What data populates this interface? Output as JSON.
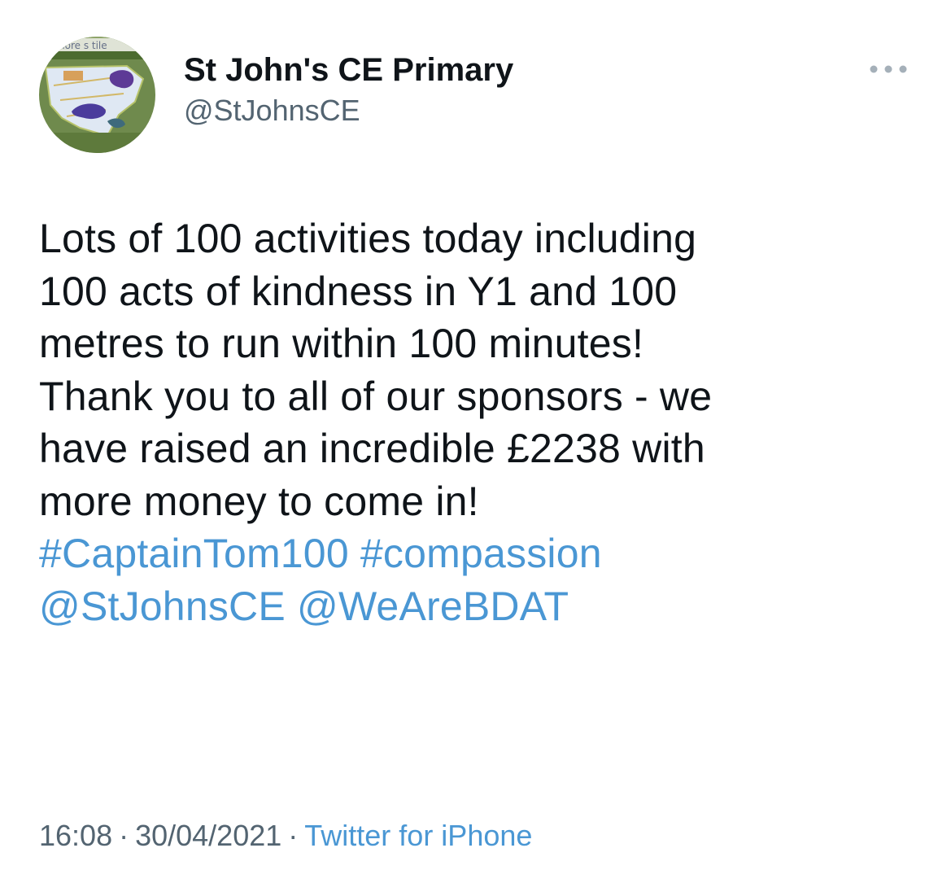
{
  "tweet": {
    "author": {
      "display_name": "St John's CE Primary",
      "handle": "@StJohnsCE",
      "avatar_text": "nore s tile"
    },
    "more_icon": "ellipsis-icon",
    "text_lines": [
      "Lots of 100 activities today including",
      "100 acts of kindness in Y1 and 100",
      "metres to run within 100 minutes!",
      "Thank you to all of our sponsors - we",
      "have raised an incredible £2238 with",
      "more money to come in!"
    ],
    "hashtags": [
      "#CaptainTom100",
      "#compassion"
    ],
    "mentions": [
      "@StJohnsCE",
      "@WeAreBDAT"
    ],
    "time": "16:08",
    "date": "30/04/2021",
    "separator": "·",
    "source": "Twitter for iPhone"
  },
  "colors": {
    "link": "#4a97d4",
    "text": "#0f1419",
    "secondary": "#536471"
  }
}
